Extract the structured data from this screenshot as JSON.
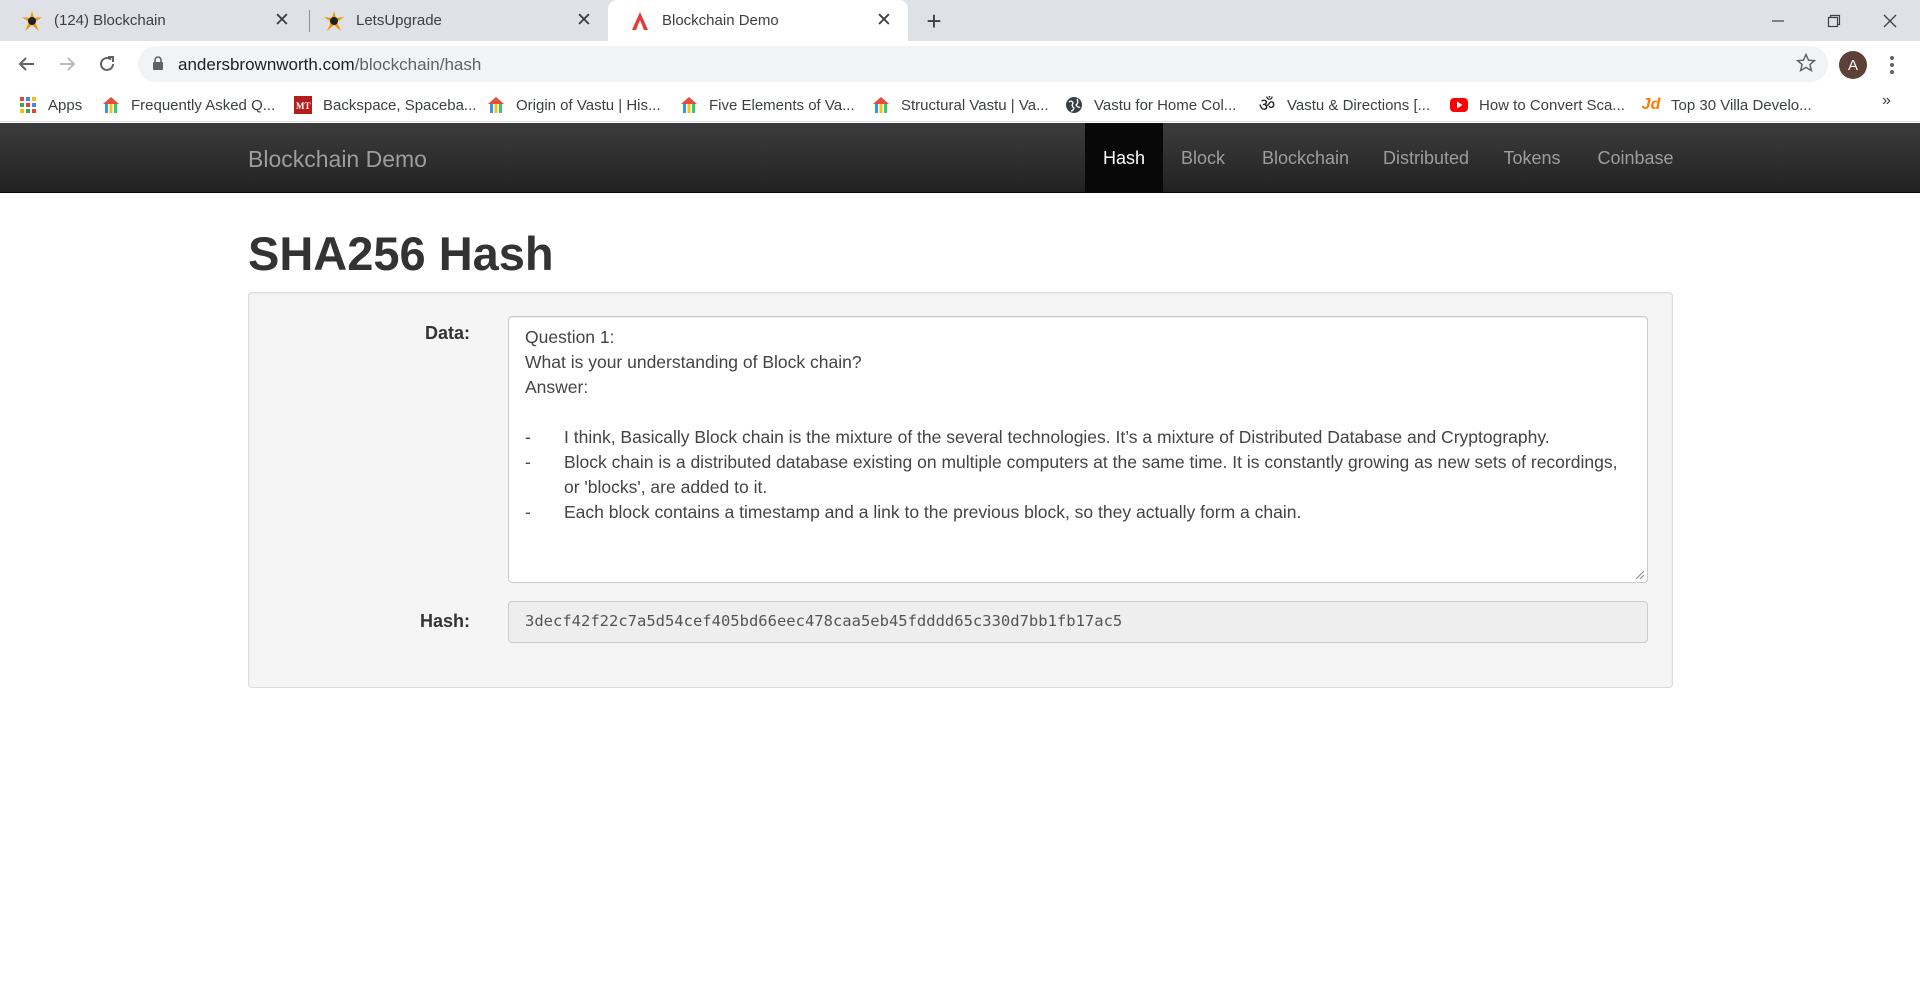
{
  "browser": {
    "tabs": [
      {
        "title": "(124) Blockchain",
        "icon": "burst-logo-icon"
      },
      {
        "title": "LetsUpgrade",
        "icon": "burst-logo-icon"
      },
      {
        "title": "Blockchain Demo",
        "icon": "red-a-logo-icon",
        "active": true
      }
    ],
    "address": {
      "host": "andersbrownworth.com",
      "path": "/blockchain/hash"
    },
    "avatar_initial": "A",
    "bookmarks": [
      {
        "label": "Apps",
        "icon": "apps-grid-icon"
      },
      {
        "label": "Frequently Asked Q...",
        "icon": "colorful-house-icon"
      },
      {
        "label": "Backspace, Spaceba...",
        "icon": "mt-logo-icon"
      },
      {
        "label": "Origin of Vastu | His...",
        "icon": "colorful-house-icon"
      },
      {
        "label": "Five Elements of Va...",
        "icon": "colorful-house-icon"
      },
      {
        "label": "Structural Vastu | Va...",
        "icon": "colorful-house-icon"
      },
      {
        "label": "Vastu for Home Col...",
        "icon": "globe-icon"
      },
      {
        "label": "Vastu & Directions [...",
        "icon": "om-symbol-icon"
      },
      {
        "label": "How to Convert Sca...",
        "icon": "youtube-icon"
      },
      {
        "label": "Top 30 Villa Develo...",
        "icon": "jd-logo-icon"
      }
    ],
    "more_bookmarks": "»"
  },
  "site": {
    "brand": "Blockchain Demo",
    "nav": [
      "Hash",
      "Block",
      "Blockchain",
      "Distributed",
      "Tokens",
      "Coinbase"
    ],
    "active_nav": "Hash"
  },
  "main": {
    "title": "SHA256 Hash",
    "data_label": "Data:",
    "hash_label": "Hash:",
    "data_lines": [
      "Question 1:",
      "What is your understanding of Block chain?",
      "Answer:",
      ""
    ],
    "data_bullets": [
      {
        "dash": "-",
        "text": "I think, Basically Block chain is the mixture of the several technologies. It’s a mixture of Distributed Database and Cryptography."
      },
      {
        "dash": "-",
        "text": "Block chain is a distributed database existing on multiple computers at the same time. It is constantly growing as new sets of recordings, or 'blocks', are added to it."
      },
      {
        "dash": "-",
        "text": "Each block contains a timestamp and a link to the previous block, so they actually form a chain."
      }
    ],
    "hash_value": "3decf42f22c7a5d54cef405bd66eec478caa5eb45fdddd65c330d7bb1fb17ac5"
  },
  "colors": {
    "navbar_bg": "#222222",
    "navbar_active": "#080808",
    "well_bg": "#f5f5f5",
    "tab_strip": "#dee1e6"
  }
}
